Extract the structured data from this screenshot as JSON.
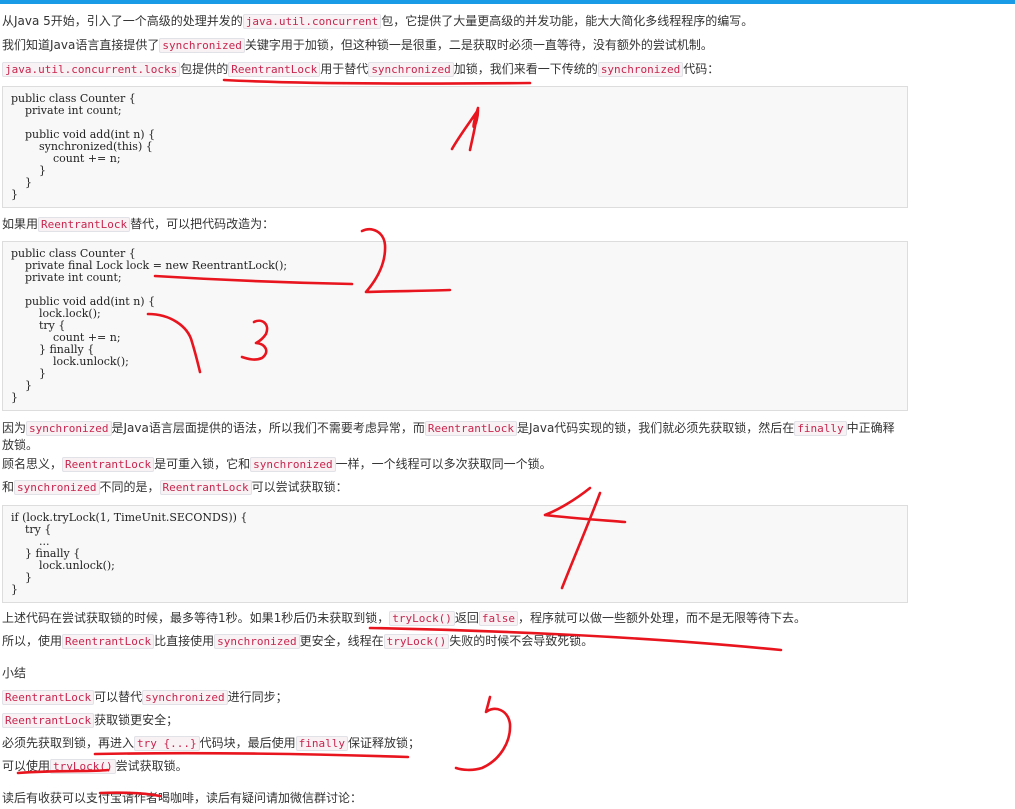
{
  "p1": {
    "t1": "从Java 5开始，引入了一个高级的处理并发的",
    "c1": "java.util.concurrent",
    "t2": "包，它提供了大量更高级的并发功能，能大大简化多线程程序的编写。"
  },
  "p2": {
    "t1": "我们知道Java语言直接提供了",
    "c1": "synchronized",
    "t2": "关键字用于加锁，但这种锁一是很重，二是获取时必须一直等待，没有额外的尝试机制。"
  },
  "p3": {
    "c1": "java.util.concurrent.locks",
    "t1": "包提供的",
    "c2": "ReentrantLock",
    "t2": "用于替代",
    "c3": "synchronized",
    "t3": "加锁，我们来看一下传统的",
    "c4": "synchronized",
    "t4": "代码："
  },
  "code1": "public class Counter {\n    private int count;\n\n    public void add(int n) {\n        synchronized(this) {\n            count += n;\n        }\n    }\n}",
  "p4": {
    "t1": "如果用",
    "c1": "ReentrantLock",
    "t2": "替代，可以把代码改造为："
  },
  "code2": "public class Counter {\n    private final Lock lock = new ReentrantLock();\n    private int count;\n\n    public void add(int n) {\n        lock.lock();\n        try {\n            count += n;\n        } finally {\n            lock.unlock();\n        }\n    }\n}",
  "p5": {
    "t1": "因为",
    "c1": "synchronized",
    "t2": "是Java语言层面提供的语法，所以我们不需要考虑异常，而",
    "c2": "ReentrantLock",
    "t3": "是Java代码实现的锁，我们就必须先获取锁，然后在",
    "c3": "finally",
    "t4": "中正确释放锁。"
  },
  "p6": {
    "t1": "顾名思义，",
    "c1": "ReentrantLock",
    "t2": "是可重入锁，它和",
    "c2": "synchronized",
    "t3": "一样，一个线程可以多次获取同一个锁。"
  },
  "p7": {
    "t1": "和",
    "c1": "synchronized",
    "t2": "不同的是，",
    "c2": "ReentrantLock",
    "t3": "可以尝试获取锁："
  },
  "code3": "if (lock.tryLock(1, TimeUnit.SECONDS)) {\n    try {\n        ...\n    } finally {\n        lock.unlock();\n    }\n}",
  "p8": {
    "t1": "上述代码在尝试获取锁的时候，最多等待1秒。如果1秒后仍未获取到锁，",
    "c1": "tryLock()",
    "t2": "返回",
    "c2": "false",
    "t3": "，程序就可以做一些额外处理，而不是无限等待下去。"
  },
  "p9": {
    "t1": "所以，使用",
    "c1": "ReentrantLock",
    "t2": "比直接使用",
    "c2": "synchronized",
    "t3": "更安全，线程在",
    "c3": "tryLock()",
    "t4": "失败的时候不会导致死锁。"
  },
  "summary": {
    "title": "小结",
    "s1": {
      "c1": "ReentrantLock",
      "t1": "可以替代",
      "c2": "synchronized",
      "t2": "进行同步；"
    },
    "s2": {
      "c1": "ReentrantLock",
      "t1": "获取锁更安全；"
    },
    "s3": {
      "t1": "必须先获取到锁，再进入",
      "c1": "try {...}",
      "t2": "代码块，最后使用",
      "c2": "finally",
      "t3": "保证释放锁；"
    },
    "s4": {
      "t1": "可以使用",
      "c1": "tryLock()",
      "t2": "尝试获取锁。"
    }
  },
  "footer": "读后有收获可以支付宝请作者喝咖啡，读后有疑问请加微信群讨论：",
  "colors": {
    "accent_bar": "#1a9be6",
    "annotation": "#e8141e",
    "inline_code": "#c7254e"
  }
}
